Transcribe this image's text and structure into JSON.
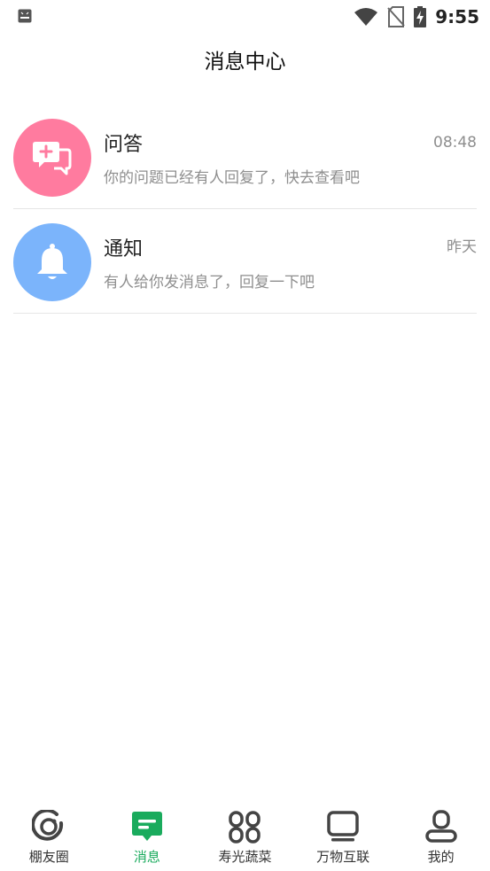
{
  "status_bar": {
    "time": "9:55"
  },
  "header": {
    "title": "消息中心"
  },
  "messages": [
    {
      "title": "问答",
      "subtitle": "你的问题已经有人回复了，快去查看吧",
      "time": "08:48",
      "icon": "chat-plus-icon",
      "color": "#ff7b9f"
    },
    {
      "title": "通知",
      "subtitle": "有人给你发消息了，回复一下吧",
      "time": "昨天",
      "icon": "bell-icon",
      "color": "#7bb4fb"
    }
  ],
  "bottom_nav": {
    "active_color": "#1aab5d",
    "tabs": [
      {
        "label": "棚友圈",
        "icon": "circle-ring-icon"
      },
      {
        "label": "消息",
        "icon": "message-icon",
        "active": true
      },
      {
        "label": "寿光蔬菜",
        "icon": "grid-icon"
      },
      {
        "label": "万物互联",
        "icon": "monitor-icon"
      },
      {
        "label": "我的",
        "icon": "profile-icon"
      }
    ]
  }
}
